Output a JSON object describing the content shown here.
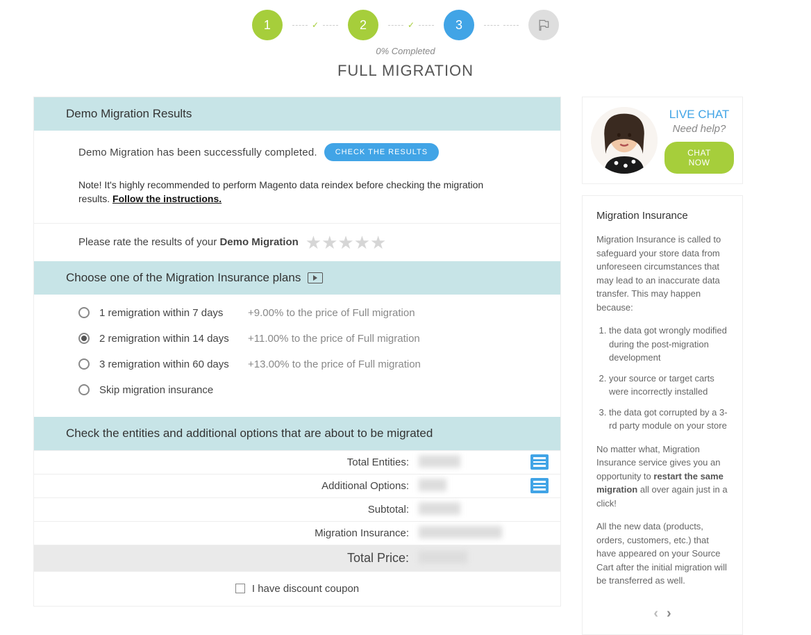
{
  "stepper": {
    "steps": [
      "1",
      "2",
      "3"
    ],
    "status": "0% Completed"
  },
  "page_title": "FULL MIGRATION",
  "demo_results": {
    "header": "Demo Migration Results",
    "success_text": "Demo Migration has been successfully completed.",
    "check_btn": "CHECK THE RESULTS",
    "note_prefix": "Note! It's highly recommended to perform Magento data reindex before checking the migration results. ",
    "note_link": "Follow the instructions."
  },
  "rating": {
    "prompt_prefix": "Please rate the results of your ",
    "prompt_bold": "Demo Migration"
  },
  "insurance": {
    "header": "Choose one of the Migration Insurance plans",
    "plans": [
      {
        "label": "1 remigration within 7 days",
        "price": "+9.00% to the price of Full migration",
        "checked": false
      },
      {
        "label": "2 remigration within 14 days",
        "price": "+11.00% to the price of Full migration",
        "checked": true
      },
      {
        "label": "3 remigration within 60 days",
        "price": "+13.00% to the price of Full migration",
        "checked": false
      },
      {
        "label": "Skip migration insurance",
        "price": "",
        "checked": false
      }
    ]
  },
  "entities": {
    "header": "Check the entities and additional options that are about to be migrated",
    "rows": [
      {
        "label": "Total Entities:",
        "action": true
      },
      {
        "label": "Additional Options:",
        "action": true
      },
      {
        "label": "Subtotal:",
        "action": false
      },
      {
        "label": "Migration Insurance:",
        "action": false
      },
      {
        "label": "Total Price:",
        "action": false,
        "highlight": true
      }
    ]
  },
  "coupon": {
    "label": "I have discount coupon"
  },
  "sidebar": {
    "chat": {
      "title": "LIVE CHAT",
      "sub": "Need help?",
      "btn": "CHAT NOW"
    },
    "info": {
      "title": "Migration Insurance",
      "intro": "Migration Insurance is called to safeguard your store data from unforeseen circumstances that may lead to an inaccurate data transfer. This may happen because:",
      "list": [
        "the data got wrongly modified during the post-migration development",
        "your source or target carts were incorrectly installed",
        "the data got corrupted by a 3-rd party module on your store"
      ],
      "p2_before": "No matter what, Migration Insurance service gives you an opportunity to ",
      "p2_strong": "restart the same migration",
      "p2_after": " all over again just in a click!",
      "p3": "All the new data (products, orders, customers, etc.) that have appeared on your Source Cart after the initial migration will be transferred as well."
    }
  }
}
